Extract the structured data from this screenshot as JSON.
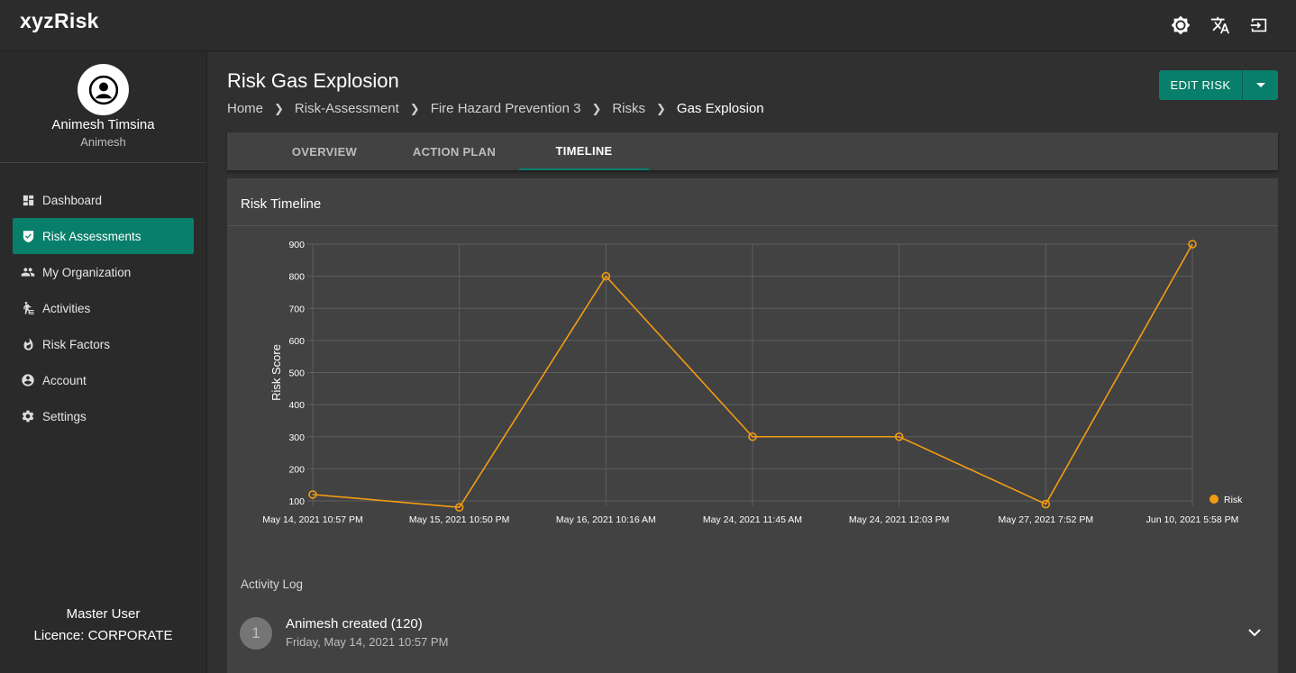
{
  "app": {
    "brand": "xyzRisk"
  },
  "topbar": {
    "icons": [
      "brightness-icon",
      "translate-icon",
      "logout-icon"
    ]
  },
  "user": {
    "name": "Animesh Timsina",
    "username": "Animesh"
  },
  "sidebar": {
    "items": [
      {
        "label": "Dashboard",
        "icon": "dashboard-icon",
        "active": false
      },
      {
        "label": "Risk Assessments",
        "icon": "shield-check-icon",
        "active": true
      },
      {
        "label": "My Organization",
        "icon": "people-icon",
        "active": false
      },
      {
        "label": "Activities",
        "icon": "activity-icon",
        "active": false
      },
      {
        "label": "Risk Factors",
        "icon": "fire-icon",
        "active": false
      },
      {
        "label": "Account",
        "icon": "account-icon",
        "active": false
      },
      {
        "label": "Settings",
        "icon": "gear-icon",
        "active": false
      }
    ],
    "footer": {
      "role": "Master User",
      "licence": "Licence: CORPORATE"
    }
  },
  "page": {
    "title": "Risk Gas Explosion",
    "breadcrumb": [
      "Home",
      "Risk-Assessment",
      "Fire Hazard Prevention 3",
      "Risks",
      "Gas Explosion"
    ],
    "edit_button": "EDIT RISK"
  },
  "tabs": [
    {
      "label": "OVERVIEW",
      "active": false
    },
    {
      "label": "ACTION PLAN",
      "active": false
    },
    {
      "label": "TIMELINE",
      "active": true
    }
  ],
  "timeline": {
    "title": "Risk Timeline",
    "activity_heading": "Activity Log",
    "log": [
      {
        "number": "1",
        "title": "Animesh created (120)",
        "date": "Friday, May 14, 2021 10:57 PM"
      }
    ]
  },
  "colors": {
    "accent": "#087f6b",
    "series": "#f39c12"
  },
  "chart_data": {
    "type": "line",
    "title": "",
    "xlabel": "",
    "ylabel": "Risk Score",
    "categories": [
      "May 14, 2021 10:57 PM",
      "May 15, 2021 10:50 PM",
      "May 16, 2021 10:16 AM",
      "May 24, 2021 11:45 AM",
      "May 24, 2021 12:03 PM",
      "May 27, 2021 7:52 PM",
      "Jun 10, 2021 5:58 PM"
    ],
    "series": [
      {
        "name": "Risk",
        "values": [
          120,
          80,
          800,
          300,
          300,
          90,
          900
        ]
      }
    ],
    "ylim": [
      100,
      900
    ],
    "yticks": [
      100,
      200,
      300,
      400,
      500,
      600,
      700,
      800,
      900
    ],
    "grid": true,
    "legend": "right"
  }
}
